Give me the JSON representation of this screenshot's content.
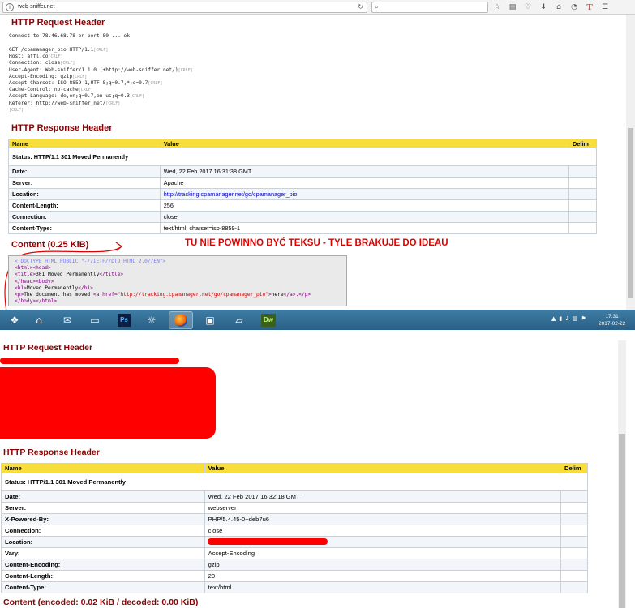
{
  "browser": {
    "url": "web-sniffer.net",
    "toolbar_icons": [
      "star-icon",
      "reading-list-icon",
      "pocket-icon",
      "download-icon",
      "home-icon",
      "sync-icon",
      "t-addon-icon",
      "menu-icon"
    ],
    "t_addon_glyph": "T"
  },
  "top": {
    "request_header_title": "HTTP Request Header",
    "connect_line": "Connect to 78.46.68.78 on port 80 ... ok",
    "request_lines": [
      "GET /cpamanager_pio HTTP/1.1",
      "Host: affl.co",
      "Connection: close",
      "User-Agent: Web-sniffer/1.1.0 (+http://web-sniffer.net/)",
      "Accept-Encoding: gzip",
      "Accept-Charset: ISO-8859-1,UTF-8;q=0.7,*;q=0.7",
      "Cache-Control: no-cache",
      "Accept-Language: de,en;q=0.7,en-us;q=0.3",
      "Referer: http://web-sniffer.net/",
      ""
    ],
    "crlf": "[CRLF]",
    "response_header_title": "HTTP Response Header",
    "table_headers": {
      "name": "Name",
      "value": "Value",
      "delim": "Delim"
    },
    "status": "Status: HTTP/1.1 301 Moved Permanently",
    "rows": [
      {
        "name": "Date:",
        "value": "Wed, 22 Feb 2017 16:31:38 GMT"
      },
      {
        "name": "Server:",
        "value": "Apache"
      },
      {
        "name": "Location:",
        "value": "http://tracking.cpamanager.net/go/cpamanager_pio"
      },
      {
        "name": "Content-Length:",
        "value": "256"
      },
      {
        "name": "Connection:",
        "value": "close"
      },
      {
        "name": "Content-Type:",
        "value": "text/html; charset=iso-8859-1"
      }
    ],
    "content_title": "Content (0.25 KiB)",
    "annotation": "TU NIE POWINNO BYĆ TEKSU - TYLE BRAKUJE DO IDEAU",
    "code": {
      "doctype": "<!DOCTYPE HTML PUBLIC \"-//IETF//DTD HTML 2.0//EN\">",
      "l2": "<html><head>",
      "l3_open": "<title>",
      "l3_text": "301 Moved Permanently",
      "l3_close": "</title>",
      "l4": "</head><body>",
      "l5_open": "<h1>",
      "l5_text": "Moved Permanently",
      "l5_close": "</h1>",
      "l6_p": "<p>",
      "l6_text": "The document has moved ",
      "l6_a_open": "<a ",
      "l6_href_attr": "href=",
      "l6_href_val": "\"http://tracking.cpamanager.net/go/cpamanager_pio\"",
      "l6_gt": ">",
      "l6_link_text": "here",
      "l6_a_close": "</a>",
      "l6_end": ".</p>",
      "l7": "</body></html>"
    }
  },
  "taskbar": {
    "apps": [
      "start-orb",
      "explorer-home-icon",
      "thunderbird-icon",
      "file-manager-icon",
      "photoshop-icon",
      "network-icon",
      "firefox-icon",
      "remote-desktop-icon",
      "notepad-icon",
      "dreamweaver-icon"
    ],
    "ps_label": "Ps",
    "dw_label": "Dw",
    "time": "17:31",
    "date": "2017-02-22"
  },
  "bottom": {
    "request_header_title": "HTTP Request Header",
    "response_header_title": "HTTP Response Header",
    "table_headers": {
      "name": "Name",
      "value": "Value",
      "delim": "Delim"
    },
    "status": "Status: HTTP/1.1 301 Moved Permanently",
    "rows": [
      {
        "name": "Date:",
        "value": "Wed, 22 Feb 2017 16:32:18 GMT"
      },
      {
        "name": "Server:",
        "value": "webserver"
      },
      {
        "name": "X-Powered-By:",
        "value": "PHP/5.4.45-0+deb7u6"
      },
      {
        "name": "Connection:",
        "value": "close"
      },
      {
        "name": "Location:",
        "value": ""
      },
      {
        "name": "Vary:",
        "value": "Accept-Encoding"
      },
      {
        "name": "Content-Encoding:",
        "value": "gzip"
      },
      {
        "name": "Content-Length:",
        "value": "20"
      },
      {
        "name": "Content-Type:",
        "value": "text/html"
      }
    ],
    "content_title": "Content (encoded: 0.02 KiB / decoded: 0.00 KiB)"
  },
  "colors": {
    "heading": "#8b0000",
    "table_header_bg": "#f7de3b",
    "annotation": "#e00000",
    "redaction": "#ff0000",
    "taskbar": "#2a5f86"
  }
}
